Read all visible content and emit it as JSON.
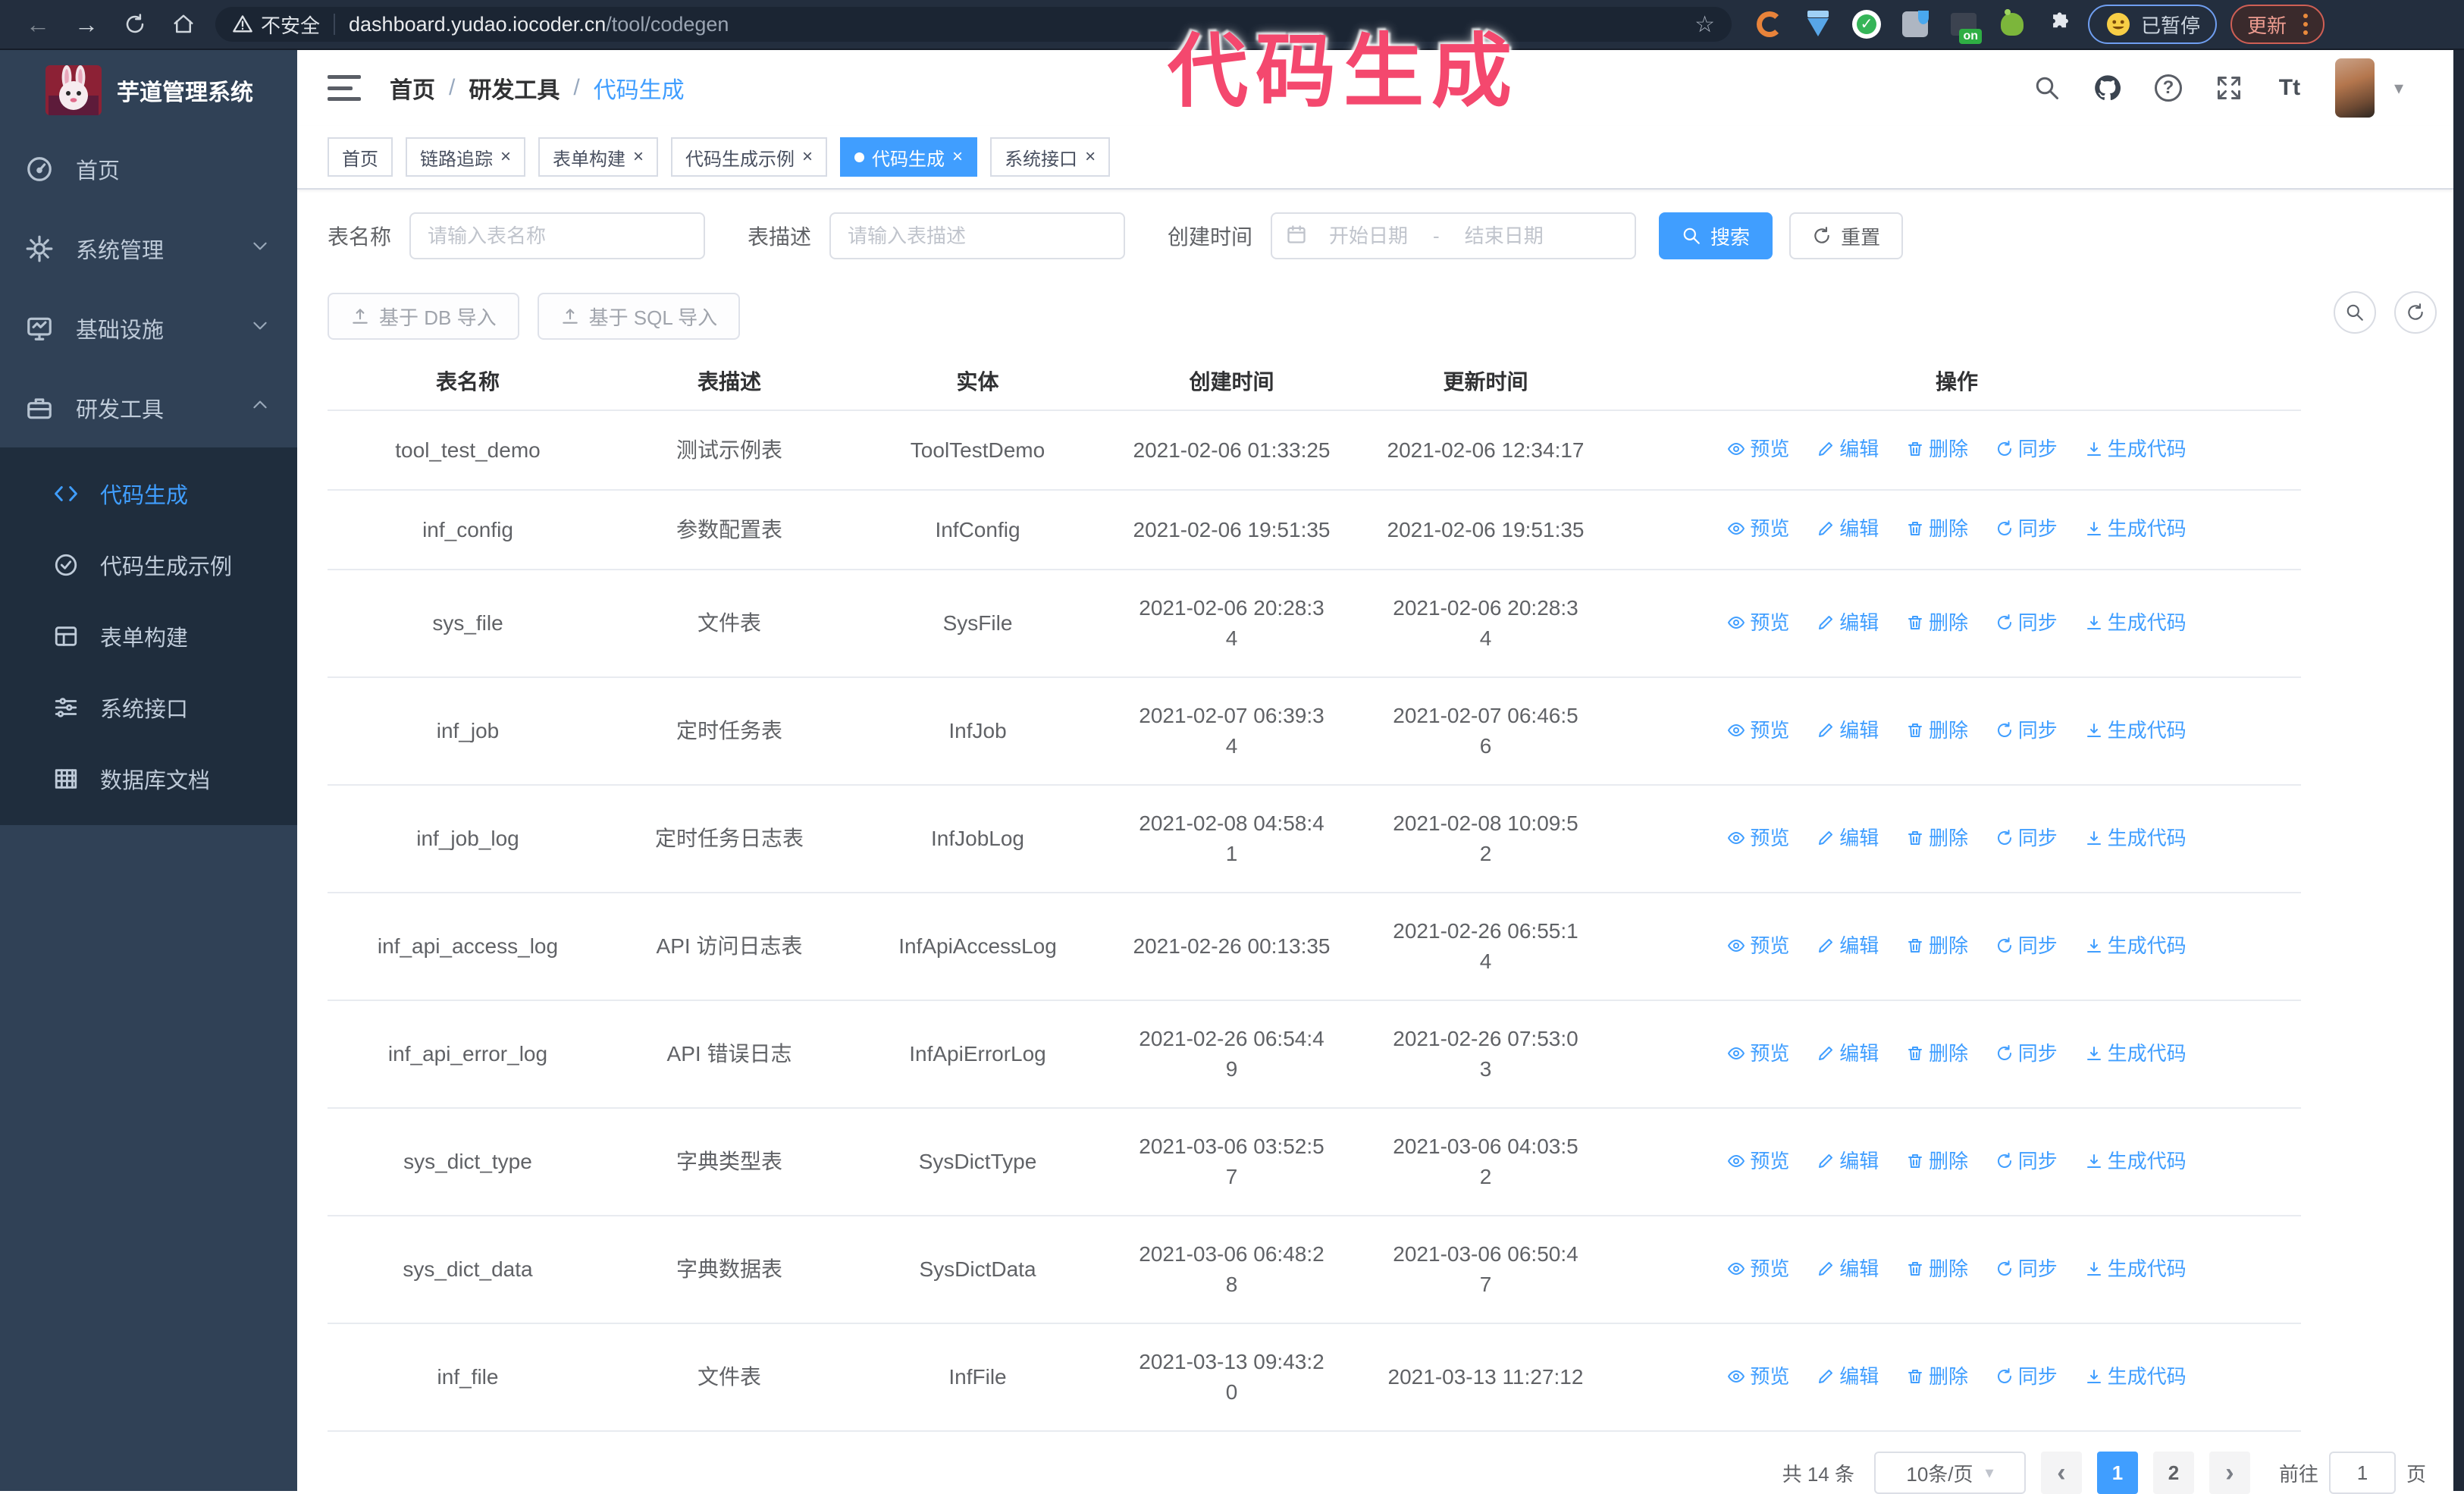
{
  "browser": {
    "security_label": "不安全",
    "url_host": "dashboard.yudao.iocoder.cn",
    "url_path": "/tool/codegen",
    "paused_label": "已暂停",
    "update_label": "更新"
  },
  "icons": {
    "back": "←",
    "forward": "→",
    "star": "☆",
    "close": "×",
    "caret_down": "▾",
    "prev": "‹",
    "next": "›",
    "question": "?",
    "check": "✓",
    "on_label": "on",
    "text_size": "Tt"
  },
  "overlay": {
    "text": "代码生成",
    "color": "#f4486e"
  },
  "sidebar": {
    "title": "芋道管理系统",
    "items": [
      {
        "label": "首页",
        "icon": "dashboard-icon"
      },
      {
        "label": "系统管理",
        "icon": "gear-icon",
        "chevron": "down"
      },
      {
        "label": "基础设施",
        "icon": "monitor-icon",
        "chevron": "down"
      },
      {
        "label": "研发工具",
        "icon": "toolbox-icon",
        "chevron": "up"
      }
    ],
    "submenu": [
      {
        "label": "代码生成",
        "icon": "code-icon",
        "active": true
      },
      {
        "label": "代码生成示例",
        "icon": "example-icon"
      },
      {
        "label": "表单构建",
        "icon": "form-icon"
      },
      {
        "label": "系统接口",
        "icon": "api-icon"
      },
      {
        "label": "数据库文档",
        "icon": "database-doc-icon"
      }
    ]
  },
  "navbar": {
    "breadcrumb": [
      "首页",
      "研发工具",
      "代码生成"
    ],
    "separator": "/"
  },
  "tags": {
    "close_glyph": "×",
    "items": [
      {
        "label": "首页",
        "closable": false,
        "active": false
      },
      {
        "label": "链路追踪",
        "closable": true,
        "active": false
      },
      {
        "label": "表单构建",
        "closable": true,
        "active": false
      },
      {
        "label": "代码生成示例",
        "closable": true,
        "active": false
      },
      {
        "label": "代码生成",
        "closable": true,
        "active": true
      },
      {
        "label": "系统接口",
        "closable": true,
        "active": false
      }
    ]
  },
  "filters": {
    "table_name_label": "表名称",
    "table_name_placeholder": "请输入表名称",
    "table_desc_label": "表描述",
    "table_desc_placeholder": "请输入表描述",
    "create_time_label": "创建时间",
    "date_start_placeholder": "开始日期",
    "date_separator": "-",
    "date_end_placeholder": "结束日期",
    "search_label": "搜索",
    "reset_label": "重置"
  },
  "toolbar": {
    "import_db_label": "基于 DB 导入",
    "import_sql_label": "基于 SQL 导入"
  },
  "table": {
    "columns": [
      "表名称",
      "表描述",
      "实体",
      "创建时间",
      "更新时间",
      "操作"
    ],
    "actions": [
      "预览",
      "编辑",
      "删除",
      "同步",
      "生成代码"
    ],
    "rows": [
      {
        "name": "tool_test_demo",
        "desc": "测试示例表",
        "entity": "ToolTestDemo",
        "created": "2021-02-06 01:33:25",
        "updated": "2021-02-06 12:34:17"
      },
      {
        "name": "inf_config",
        "desc": "参数配置表",
        "entity": "InfConfig",
        "created": "2021-02-06 19:51:35",
        "updated": "2021-02-06 19:51:35"
      },
      {
        "name": "sys_file",
        "desc": "文件表",
        "entity": "SysFile",
        "created": "2021-02-06 20:28:3\n4",
        "updated": "2021-02-06 20:28:3\n4"
      },
      {
        "name": "inf_job",
        "desc": "定时任务表",
        "entity": "InfJob",
        "created": "2021-02-07 06:39:3\n4",
        "updated": "2021-02-07 06:46:5\n6"
      },
      {
        "name": "inf_job_log",
        "desc": "定时任务日志表",
        "entity": "InfJobLog",
        "created": "2021-02-08 04:58:4\n1",
        "updated": "2021-02-08 10:09:5\n2"
      },
      {
        "name": "inf_api_access_log",
        "desc": "API 访问日志表",
        "entity": "InfApiAccessLog",
        "created": "2021-02-26 00:13:35",
        "updated": "2021-02-26 06:55:1\n4"
      },
      {
        "name": "inf_api_error_log",
        "desc": "API 错误日志",
        "entity": "InfApiErrorLog",
        "created": "2021-02-26 06:54:4\n9",
        "updated": "2021-02-26 07:53:0\n3"
      },
      {
        "name": "sys_dict_type",
        "desc": "字典类型表",
        "entity": "SysDictType",
        "created": "2021-03-06 03:52:5\n7",
        "updated": "2021-03-06 04:03:5\n2"
      },
      {
        "name": "sys_dict_data",
        "desc": "字典数据表",
        "entity": "SysDictData",
        "created": "2021-03-06 06:48:2\n8",
        "updated": "2021-03-06 06:50:4\n7"
      },
      {
        "name": "inf_file",
        "desc": "文件表",
        "entity": "InfFile",
        "created": "2021-03-13 09:43:2\n0",
        "updated": "2021-03-13 11:27:12"
      }
    ]
  },
  "pagination": {
    "total": "共 14 条",
    "page_size": "10条/页",
    "pages": [
      "1",
      "2"
    ],
    "active_page": "1",
    "goto_label": "前往",
    "goto_value": "1",
    "unit_label": "页"
  },
  "colors": {
    "primary": "#409eff",
    "sidebar_bg": "#304156",
    "submenu_bg": "#1f2d3d",
    "overlay_pink": "#f4486e",
    "chrome_bg": "#232e3e"
  }
}
